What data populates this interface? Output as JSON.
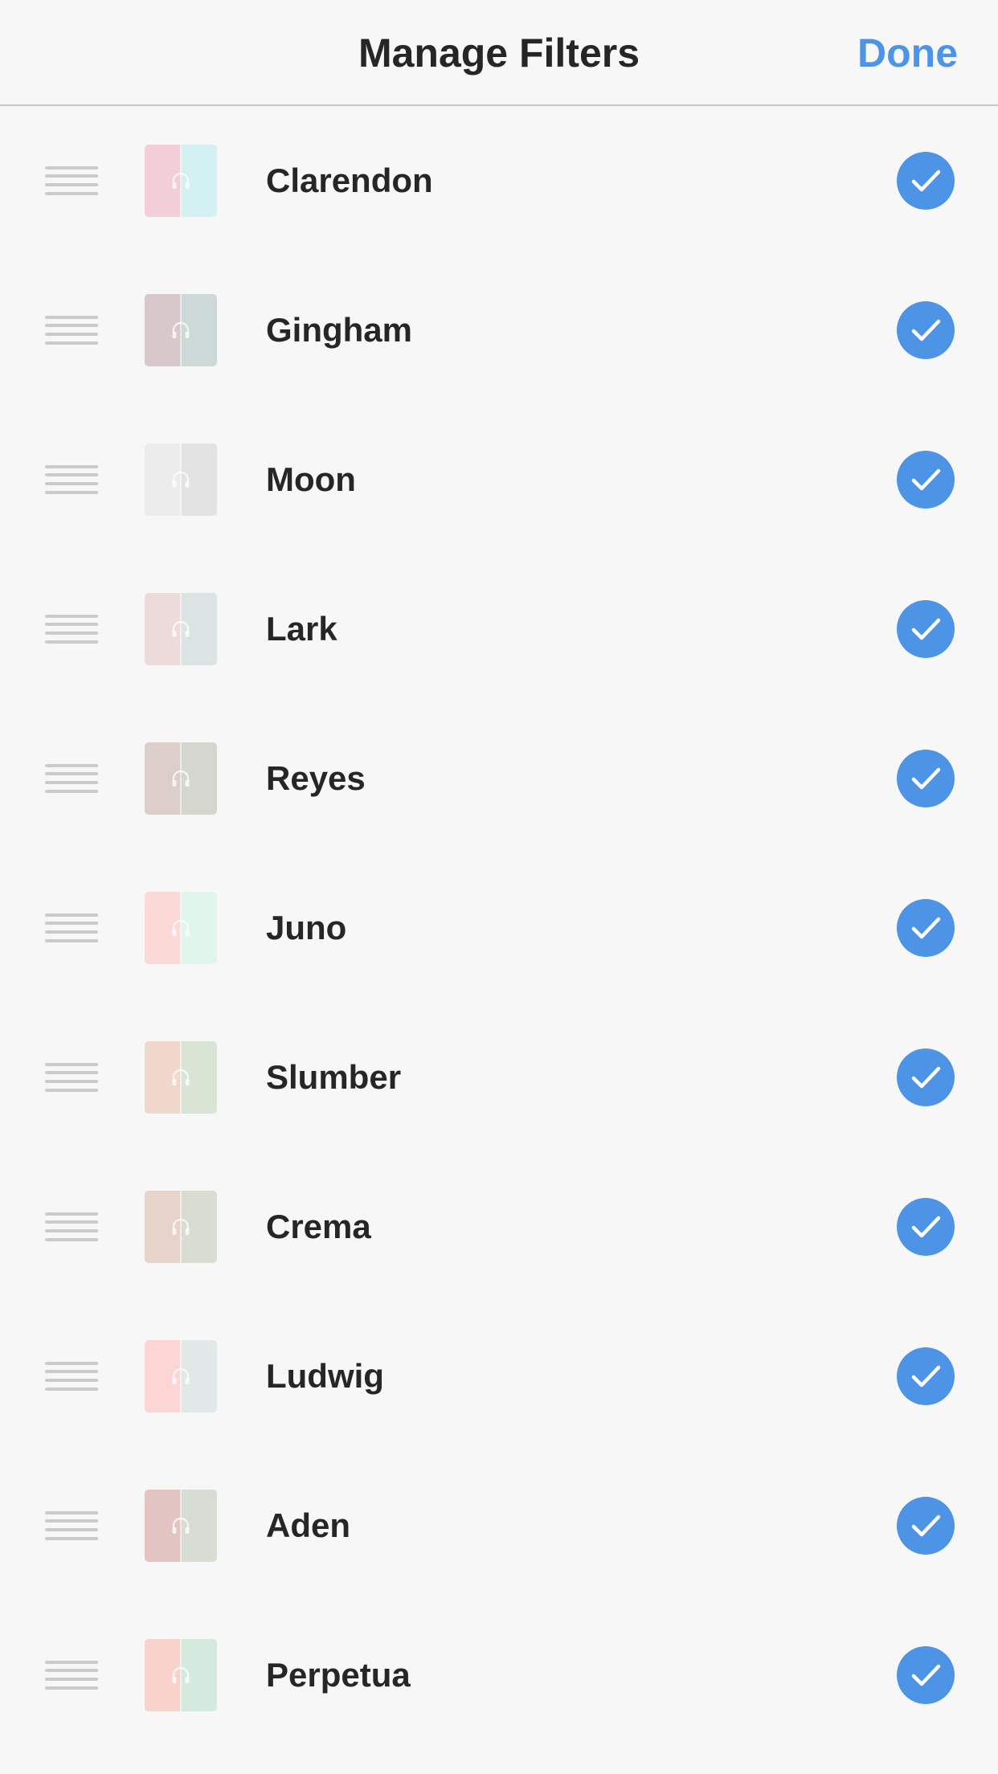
{
  "header": {
    "title": "Manage Filters",
    "done_label": "Done"
  },
  "colors": {
    "accent": "#4e94e6",
    "background": "#f7f7f8",
    "text": "#262626",
    "handle": "#cbcbcb"
  },
  "filters": [
    {
      "name": "Clarendon",
      "selected": true,
      "thumb_left": "#f2cfd8",
      "thumb_right": "#d3f0f3"
    },
    {
      "name": "Gingham",
      "selected": true,
      "thumb_left": "#d8c8cb",
      "thumb_right": "#cdd9d6"
    },
    {
      "name": "Moon",
      "selected": true,
      "thumb_left": "#ececec",
      "thumb_right": "#e3e3e3"
    },
    {
      "name": "Lark",
      "selected": true,
      "thumb_left": "#eddadb",
      "thumb_right": "#dce4e3"
    },
    {
      "name": "Reyes",
      "selected": true,
      "thumb_left": "#dccfcb",
      "thumb_right": "#d6d6d1"
    },
    {
      "name": "Juno",
      "selected": true,
      "thumb_left": "#fbd9d6",
      "thumb_right": "#e0f5ec"
    },
    {
      "name": "Slumber",
      "selected": true,
      "thumb_left": "#f0d7cc",
      "thumb_right": "#d9e5d4"
    },
    {
      "name": "Crema",
      "selected": true,
      "thumb_left": "#e6d4cb",
      "thumb_right": "#d9ddd1"
    },
    {
      "name": "Ludwig",
      "selected": true,
      "thumb_left": "#fbd6d5",
      "thumb_right": "#e2e8e8"
    },
    {
      "name": "Aden",
      "selected": true,
      "thumb_left": "#e2c4c3",
      "thumb_right": "#d7dcd5"
    },
    {
      "name": "Perpetua",
      "selected": true,
      "thumb_left": "#f8d3cc",
      "thumb_right": "#d4eadf"
    }
  ]
}
